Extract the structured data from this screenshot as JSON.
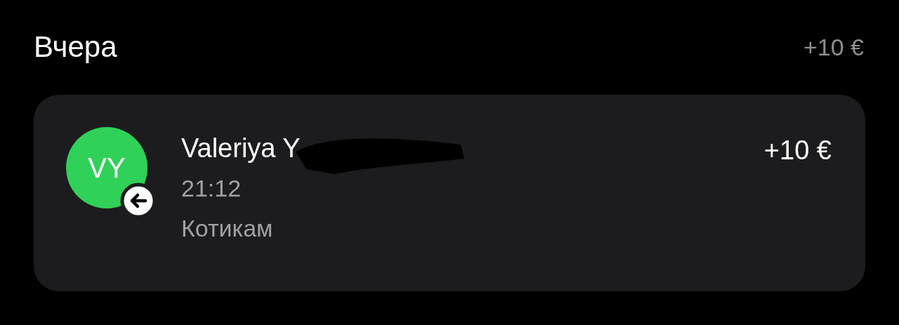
{
  "day_header": {
    "title": "Вчера",
    "total": "+10 €"
  },
  "transactions": [
    {
      "initials": "VY",
      "color": "#30d158",
      "incoming": true,
      "name": "Valeriya Y",
      "redacted": true,
      "time": "21:12",
      "comment": "Котикам",
      "amount": "+10 €"
    }
  ]
}
